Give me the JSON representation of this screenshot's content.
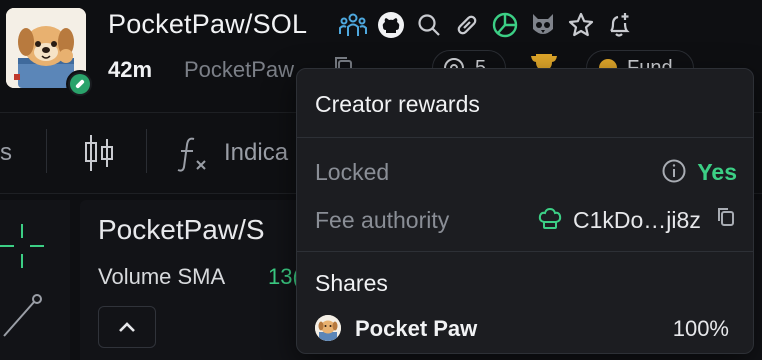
{
  "header": {
    "pair_title": "PocketPaw/SOL",
    "age": "42m",
    "handle": "PocketPaw",
    "holders_count": "5",
    "fund_label": "Fund",
    "icons": [
      "community-icon",
      "github-icon",
      "search-icon",
      "link-icon",
      "pie-chart-icon",
      "owl-icon",
      "star-icon",
      "bell-plus-icon"
    ]
  },
  "toolbar": {
    "partial_left": "s",
    "indicators_label": "Indica"
  },
  "chart": {
    "title": "PocketPaw/S",
    "volume_label": "Volume SMA",
    "volume_value": "13("
  },
  "popover": {
    "title": "Creator rewards",
    "locked_label": "Locked",
    "locked_value": "Yes",
    "fee_authority_label": "Fee authority",
    "fee_authority_value": "C1kDo…ji8z",
    "shares_title": "Shares",
    "shares": [
      {
        "name": "Pocket Paw",
        "percent": "100%"
      }
    ]
  },
  "colors": {
    "accent_green": "#3ccf85",
    "background": "#0e0f12",
    "popover_bg": "#1c1d21",
    "muted_text": "#8a8e96",
    "community_blue": "#4ea8de"
  }
}
